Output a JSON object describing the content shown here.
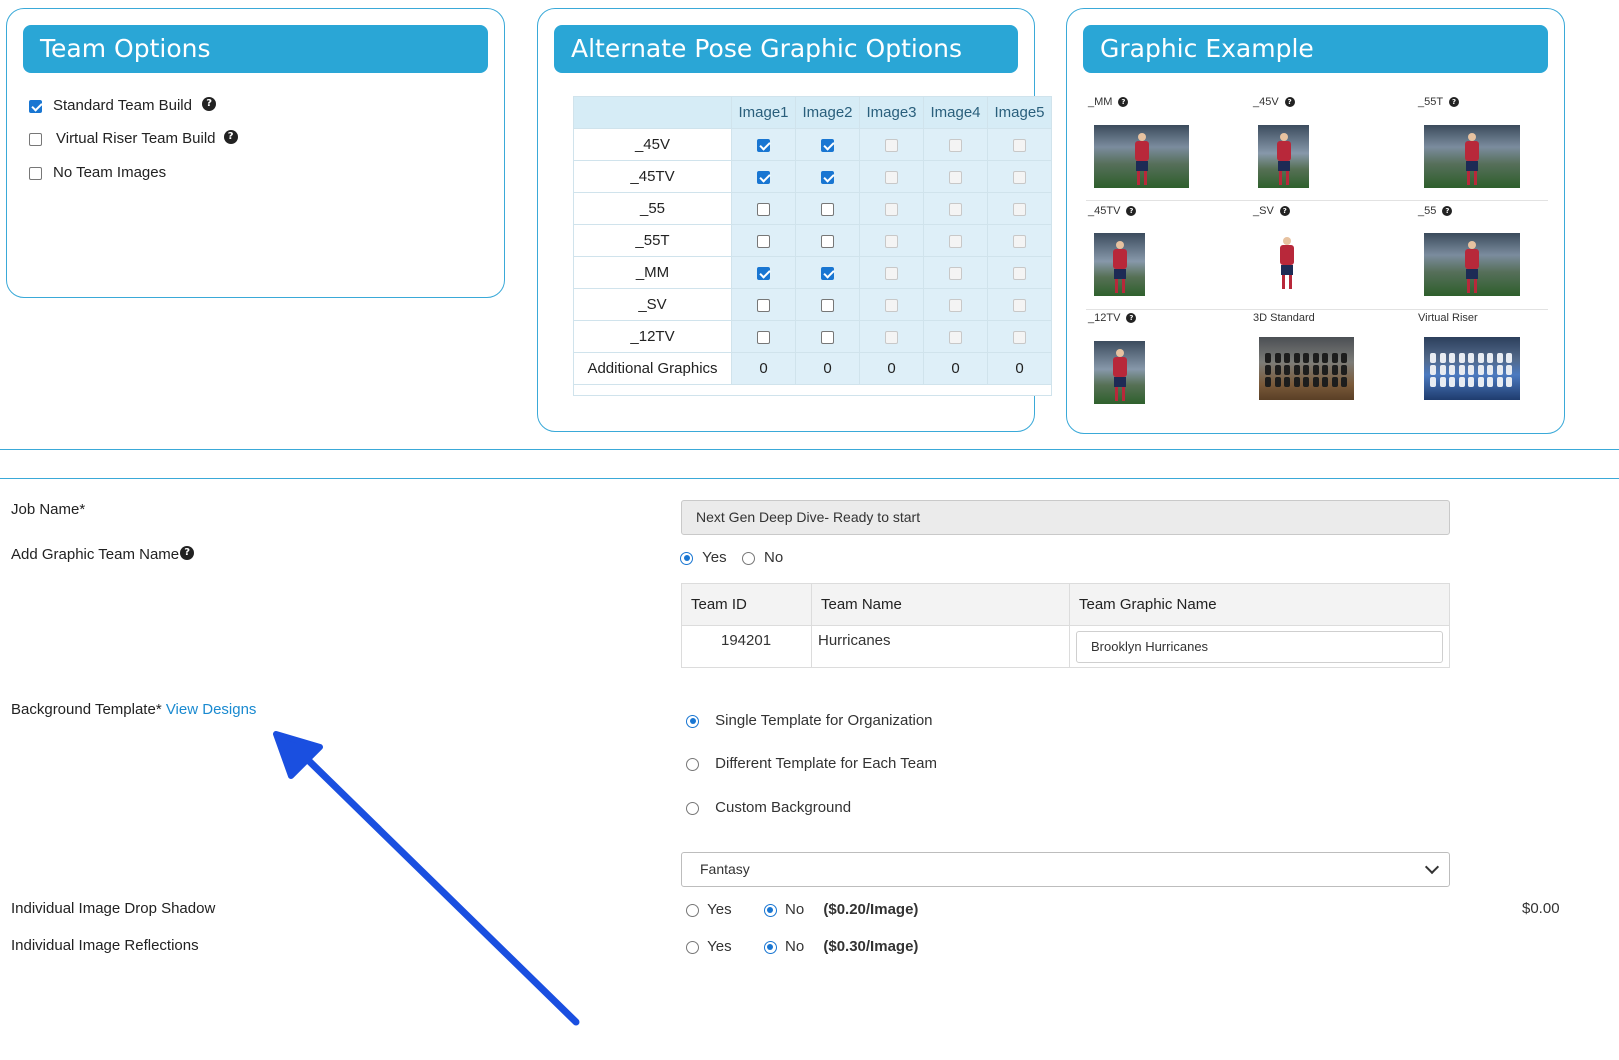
{
  "team_options": {
    "title": "Team Options",
    "items": [
      {
        "label": "Standard Team Build",
        "checked": true,
        "help_icon": "question-circle-icon"
      },
      {
        "label": "Virtual Riser Team Build",
        "checked": false,
        "help_icon": "question-circle-icon"
      },
      {
        "label": "No Team Images",
        "checked": false
      }
    ]
  },
  "alt_pose": {
    "title": "Alternate Pose Graphic Options",
    "columns": [
      "Image1",
      "Image2",
      "Image3",
      "Image4",
      "Image5"
    ],
    "rows": [
      {
        "label": "_45V",
        "checks": [
          true,
          true,
          false,
          false,
          false
        ]
      },
      {
        "label": "_45TV",
        "checks": [
          true,
          true,
          false,
          false,
          false
        ]
      },
      {
        "label": "_55",
        "checks": [
          false,
          false,
          false,
          false,
          false
        ]
      },
      {
        "label": "_55T",
        "checks": [
          false,
          false,
          false,
          false,
          false
        ]
      },
      {
        "label": "_MM",
        "checks": [
          true,
          true,
          false,
          false,
          false
        ]
      },
      {
        "label": "_SV",
        "checks": [
          false,
          false,
          false,
          false,
          false
        ]
      },
      {
        "label": "_12TV",
        "checks": [
          false,
          false,
          false,
          false,
          false
        ]
      }
    ],
    "additional_label": "Additional Graphics",
    "additional_values": [
      "0",
      "0",
      "0",
      "0",
      "0"
    ]
  },
  "graphic_example": {
    "title": "Graphic Example",
    "items": [
      {
        "label": "_MM",
        "has_help": true
      },
      {
        "label": "_45V",
        "has_help": true
      },
      {
        "label": "_55T",
        "has_help": true
      },
      {
        "label": "_45TV",
        "has_help": true
      },
      {
        "label": "_SV",
        "has_help": true
      },
      {
        "label": "_55",
        "has_help": true
      },
      {
        "label": "_12TV",
        "has_help": true
      },
      {
        "label": "3D Standard",
        "has_help": false
      },
      {
        "label": "Virtual Riser",
        "has_help": false
      }
    ]
  },
  "form": {
    "job_name": {
      "label": "Job Name*",
      "value": "Next Gen Deep Dive- Ready to start"
    },
    "graphic_team_name": {
      "label": "Add Graphic Team Name",
      "options": [
        {
          "label": "Yes",
          "selected": true
        },
        {
          "label": "No",
          "selected": false
        }
      ]
    },
    "team_table": {
      "headers": [
        "Team ID",
        "Team Name",
        "Team Graphic Name"
      ],
      "row": {
        "team_id": "194201",
        "team_name": "Hurricanes",
        "graphic_name": "Brooklyn Hurricanes"
      }
    },
    "background_template": {
      "label": "Background Template*",
      "link": "View Designs",
      "options": [
        {
          "label": "Single Template for Organization",
          "selected": true
        },
        {
          "label": "Different Template for Each Team",
          "selected": false
        },
        {
          "label": "Custom Background",
          "selected": false
        }
      ],
      "selected_design": "Fantasy"
    },
    "drop_shadow": {
      "label": "Individual Image Drop Shadow",
      "yes": "Yes",
      "no": "No",
      "selected": "No",
      "price": "($0.20/Image)",
      "total": "$0.00"
    },
    "reflections": {
      "label": "Individual Image Reflections",
      "yes": "Yes",
      "no": "No",
      "selected": "No",
      "price": "($0.30/Image)"
    }
  },
  "colors": {
    "accent": "#2aa6d6",
    "border": "#3aa9d8",
    "check": "#1976d2",
    "arrow": "#1a4fe0"
  }
}
